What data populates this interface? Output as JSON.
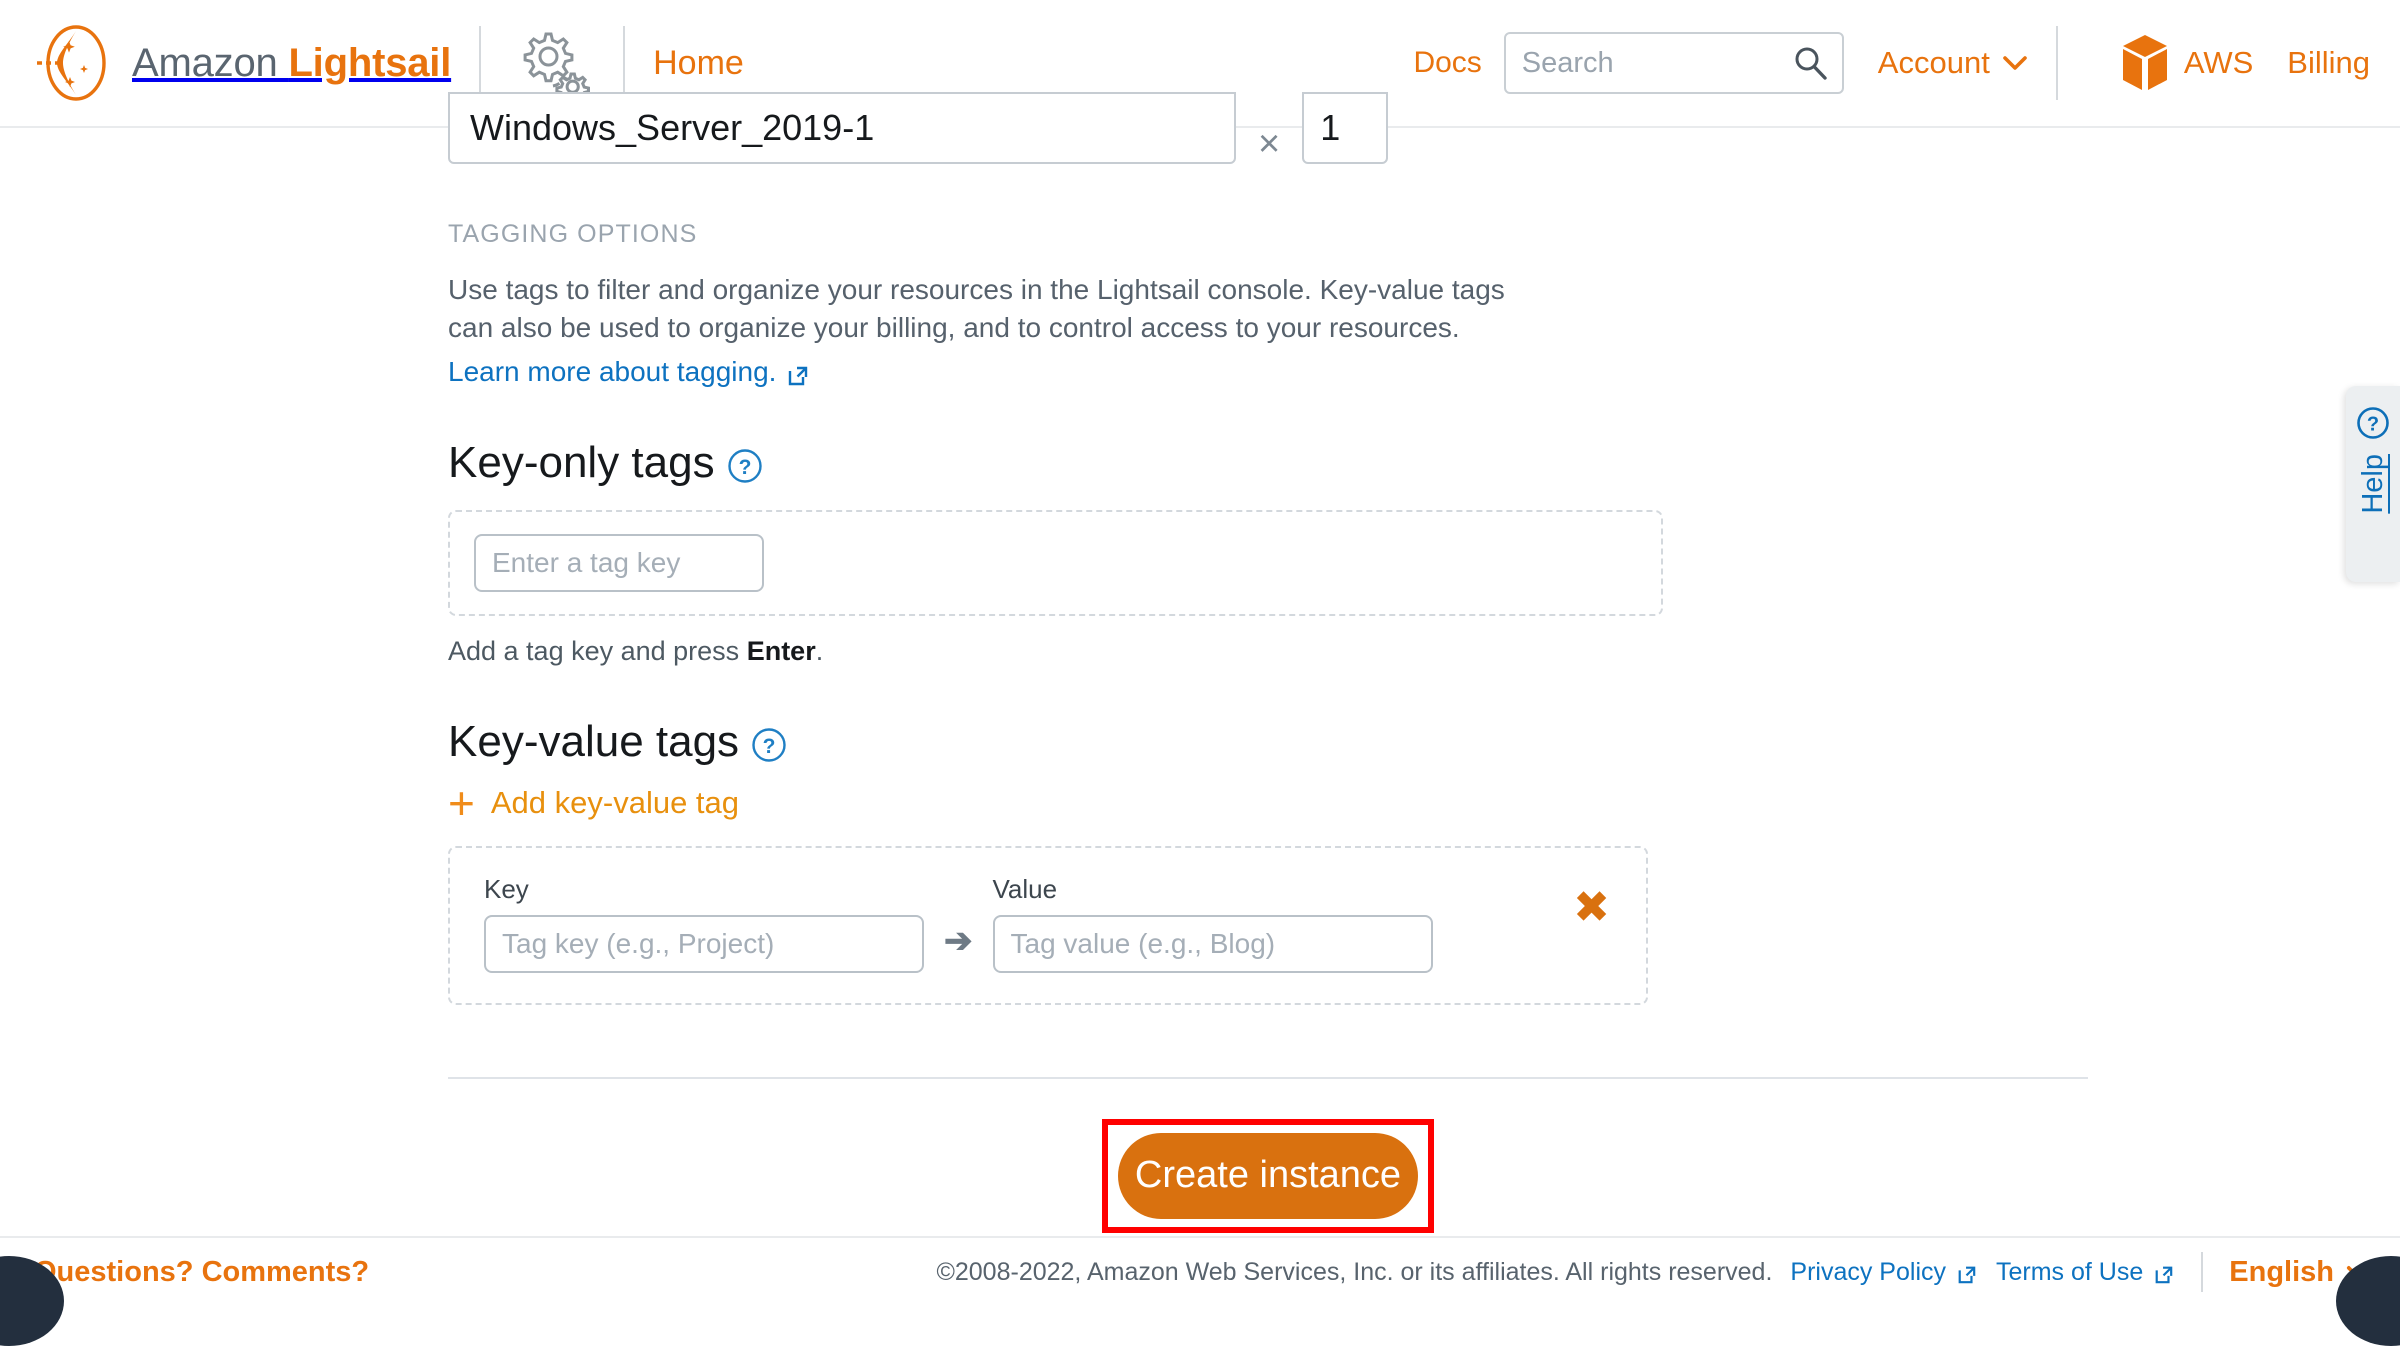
{
  "header": {
    "brand_amazon": "Amazon ",
    "brand_lightsail": "Lightsail",
    "home_label": "Home",
    "docs_label": "Docs",
    "search_placeholder": "Search",
    "search_value": "",
    "account_label": "Account",
    "account_caret": "⌄",
    "aws_label": "AWS",
    "billing_label": "Billing"
  },
  "form": {
    "instance_name_value": "Windows_Server_2019-1",
    "multiply_symbol": "×",
    "quantity_value": "1"
  },
  "tagging": {
    "kicker": "TAGGING OPTIONS",
    "description": "Use tags to filter and organize your resources in the Lightsail console. Key-value tags can also be used to organize your billing, and to control access to your resources.",
    "learn_more": "Learn more about tagging."
  },
  "key_only": {
    "heading": "Key-only tags",
    "input_placeholder": "Enter a tag key",
    "input_value": "",
    "hint_prefix": "Add a tag key and press ",
    "hint_key": "Enter",
    "hint_suffix": "."
  },
  "key_value": {
    "heading": "Key-value tags",
    "add_label": "Add key-value tag",
    "add_plus": "+",
    "key_label": "Key",
    "value_label": "Value",
    "key_placeholder": "Tag key (e.g., Project)",
    "key_value_field": "",
    "value_placeholder": "Tag value (e.g., Blog)",
    "value_value": "",
    "arrow": "➔",
    "remove_label": "✖"
  },
  "actions": {
    "create_label": "Create instance"
  },
  "help": {
    "label": "Help"
  },
  "footer": {
    "questions_label": "Questions? Comments?",
    "copyright": "©2008-2022, Amazon Web Services, Inc. or its affiliates. All rights reserved.",
    "privacy_label": "Privacy Policy",
    "terms_label": "Terms of Use",
    "language_label": "English",
    "language_caret": "⌄"
  },
  "colors": {
    "brand_orange": "#e8730e",
    "button_orange": "#d9710f",
    "link_blue": "#0d72c0",
    "highlight_red": "#ff0000",
    "text_dark": "#16191c",
    "text_muted": "#56616c"
  }
}
